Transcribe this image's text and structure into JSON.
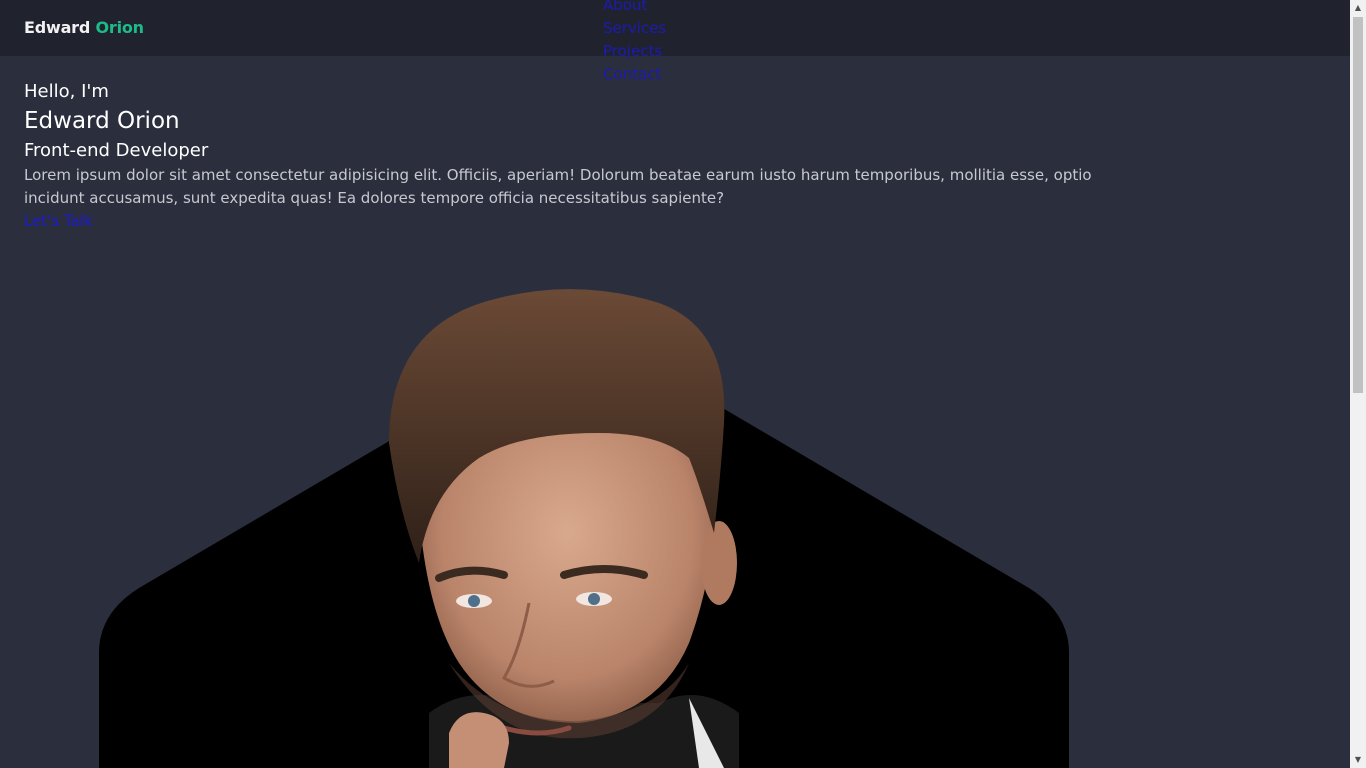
{
  "header": {
    "logo_first": "Edward",
    "logo_second": "Orion",
    "nav": [
      {
        "label": "About"
      },
      {
        "label": "Services"
      },
      {
        "label": "Projects"
      },
      {
        "label": "Contact"
      }
    ]
  },
  "hero": {
    "greeting": "Hello, I'm",
    "name": "Edward Orion",
    "role": "Front-end Developer",
    "description": "Lorem ipsum dolor sit amet consectetur adipisicing elit. Officiis, aperiam! Dolorum beatae earum iusto harum temporibus, mollitia esse, optio incidunt accusamus, sunt expedita quas! Ea dolores tempore officia necessitatibus sapiente?",
    "cta": "Let's Talk"
  },
  "colors": {
    "background": "#2b2e3c",
    "header": "#20232d",
    "accent": "#1dbb8a",
    "link": "#1b1bb3"
  },
  "icons": {
    "scroll_up": "triangle-up-icon",
    "scroll_down": "triangle-down-icon"
  }
}
